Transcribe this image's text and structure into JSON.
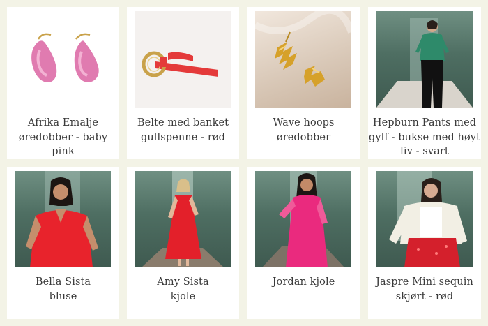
{
  "products": [
    {
      "title": "Afrika Emalje\nøredobber - baby pink",
      "image": "pink-hoop-earrings-photo"
    },
    {
      "title": "Belte med banket\ngullspenne - rød",
      "image": "red-belt-gold-buckle-photo"
    },
    {
      "title": "Wave hoops\nøredobber",
      "image": "gold-wave-hoop-earrings-photo"
    },
    {
      "title": "Hepburn Pants med\ngylf - bukse med høyt\nliv - svart",
      "image": "model-black-high-waist-pants-photo"
    },
    {
      "title": "Bella Sista\nbluse",
      "image": "model-red-blouse-photo"
    },
    {
      "title": "Amy Sista\nkjole",
      "image": "model-red-dress-photo"
    },
    {
      "title": "Jordan kjole",
      "image": "model-pink-lace-dress-photo"
    },
    {
      "title": "Jaspre Mini sequin\nskjørt - rød",
      "image": "model-red-sequin-skirt-photo"
    }
  ]
}
